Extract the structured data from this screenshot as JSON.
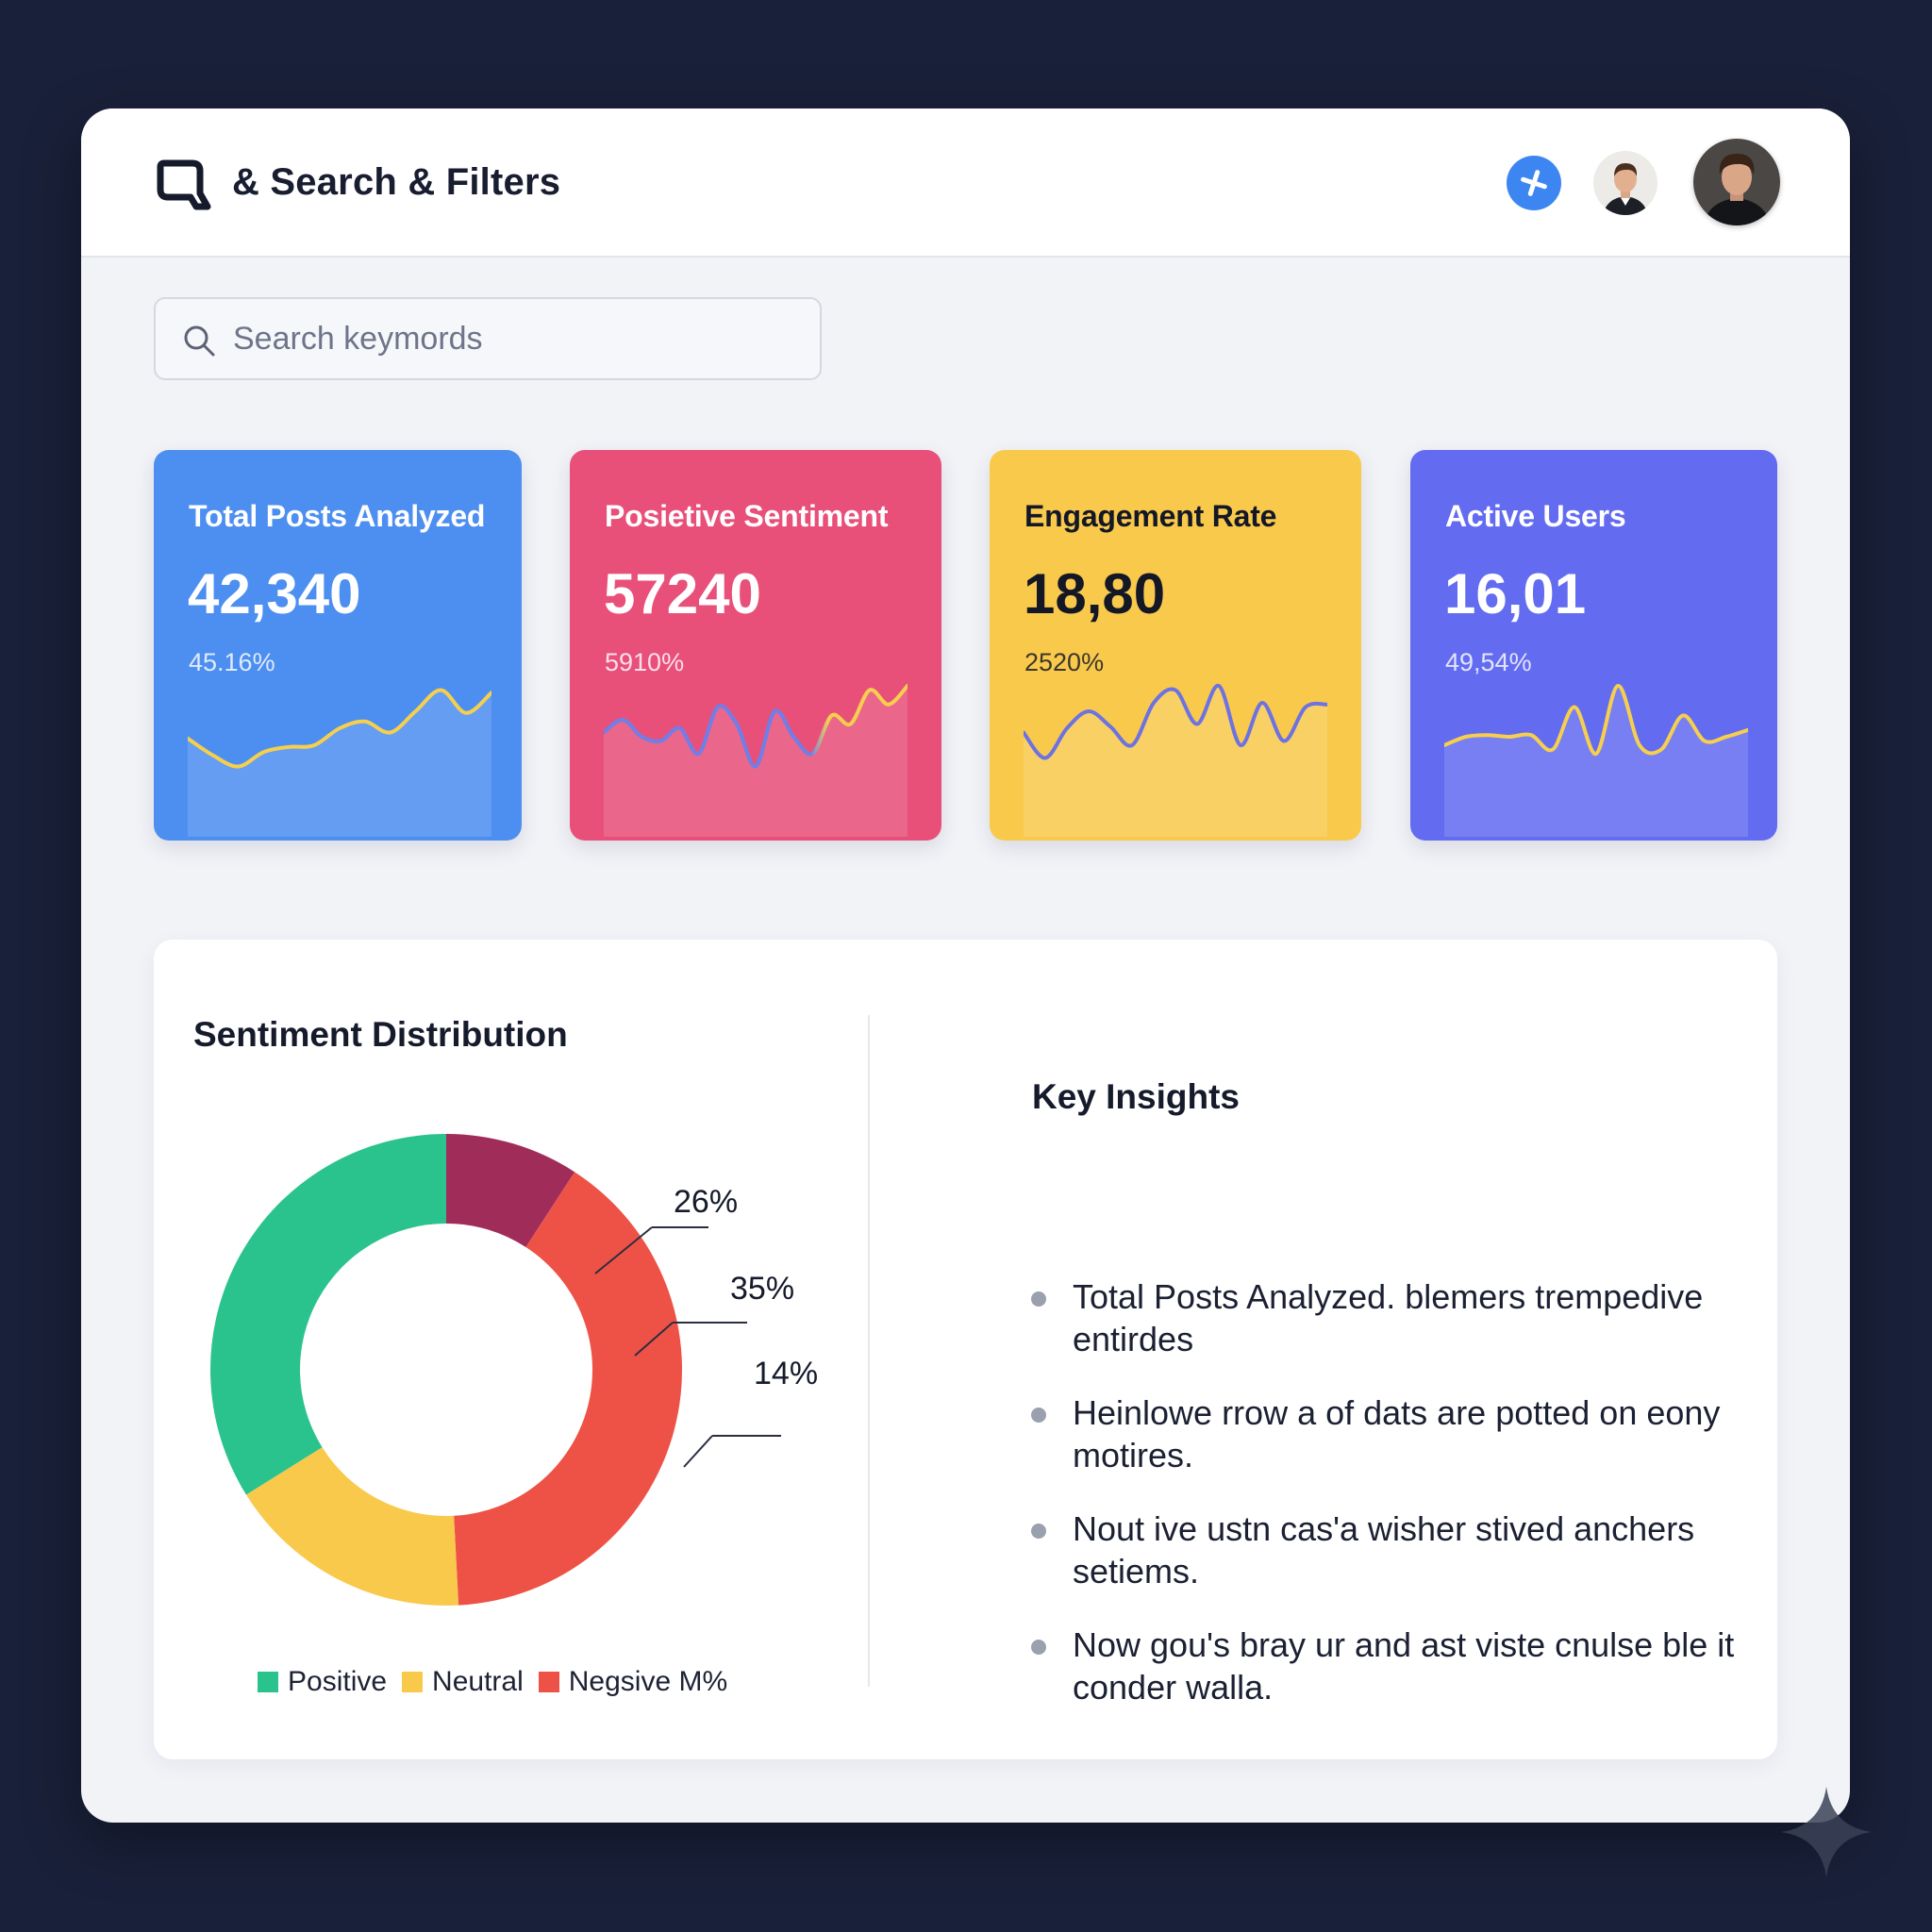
{
  "header": {
    "title": "& Search & Filters",
    "logo_icon": "search-logo-icon",
    "add_icon": "plus-icon"
  },
  "search": {
    "placeholder": "Search keymords",
    "value": ""
  },
  "cards": [
    {
      "title": "Total Posts Analyzed",
      "value": "42,340",
      "sub": "45.16%",
      "bg": "#4d8ff0",
      "text_color": "#ffffff",
      "line_color": "#f6cf4e",
      "trend": [
        0.38,
        0.18,
        0.05,
        0.22,
        0.28,
        0.3,
        0.5,
        0.58,
        0.45,
        0.7,
        0.95,
        0.68,
        0.92
      ]
    },
    {
      "title": "Posietive Sentiment",
      "value": "57240",
      "sub": "5910%",
      "bg": "#e8507a",
      "text_color": "#ffffff",
      "line_color": "#6f7ee8",
      "line_color_2": "#f6cf4e",
      "trend": [
        0.45,
        0.6,
        0.4,
        0.35,
        0.5,
        0.2,
        0.75,
        0.55,
        0.05,
        0.7,
        0.4,
        0.2,
        0.65,
        0.55,
        0.95,
        0.78,
        1.0
      ]
    },
    {
      "title": "Engagement Rate",
      "value": "18,80",
      "sub": "2520%",
      "bg": "#f9c94c",
      "text_color": "#131726",
      "line_color": "#6d72e2",
      "trend": [
        0.45,
        0.15,
        0.5,
        0.7,
        0.52,
        0.3,
        0.8,
        0.95,
        0.55,
        1.0,
        0.3,
        0.8,
        0.35,
        0.75,
        0.78
      ]
    },
    {
      "title": "Active Users",
      "value": "16,01",
      "sub": "49,54%",
      "bg": "#636cf0",
      "text_color": "#ffffff",
      "line_color": "#f6cf4e",
      "trend": [
        0.3,
        0.4,
        0.42,
        0.4,
        0.42,
        0.25,
        0.75,
        0.2,
        1.0,
        0.3,
        0.25,
        0.65,
        0.35,
        0.4,
        0.48
      ]
    }
  ],
  "sentiment": {
    "title": "Sentiment Distribution",
    "labels": [
      "26%",
      "35%",
      "14%"
    ],
    "legend": [
      {
        "label": "Positive",
        "color": "#2bc38d"
      },
      {
        "label": "Neutral",
        "color": "#f9c94c"
      },
      {
        "label": "Negsive M%",
        "color": "#ee5246"
      }
    ],
    "segments": [
      {
        "name": "dark",
        "color": "#a02c5a",
        "start": 0,
        "end": 33
      },
      {
        "name": "negative",
        "color": "#ee5246",
        "start": 33,
        "end": 177
      },
      {
        "name": "neutral",
        "color": "#f9c94c",
        "start": 177,
        "end": 238
      },
      {
        "name": "positive",
        "color": "#2bc38d",
        "start": 238,
        "end": 360
      }
    ]
  },
  "insights": {
    "title": "Key Insights",
    "items": [
      "Total Posts Analyzed. blemers trempedive entirdes",
      "Heinlowe rrow a of dats are potted on eony motires.",
      "Nout ive ustn cas'a wisher stived anchers setiems.",
      "Now gou's bray ur and ast viste cnulse ble it conder walla."
    ]
  }
}
